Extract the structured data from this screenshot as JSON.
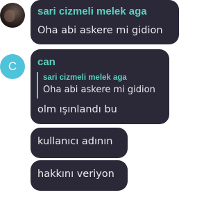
{
  "messages": [
    {
      "sender": "sari cizmeli melek aga",
      "avatar_icon": "user-photo-icon",
      "text": "Oha abi askere mi gidion"
    },
    {
      "sender": "can",
      "avatar_letter": "C",
      "avatar_color": "#4fc3d9",
      "reply": {
        "sender": "sari cizmeli melek aga",
        "text": "Oha abi askere mi gidion"
      },
      "text": "olm ışınlandı bu"
    },
    {
      "text": "kullanıcı adının"
    },
    {
      "text": "hakkını veriyon"
    }
  ],
  "colors": {
    "bubble": "#2b2838",
    "name_accent": "#5ad1c1",
    "message_text": "#ececf0",
    "background": "#ffffff"
  }
}
